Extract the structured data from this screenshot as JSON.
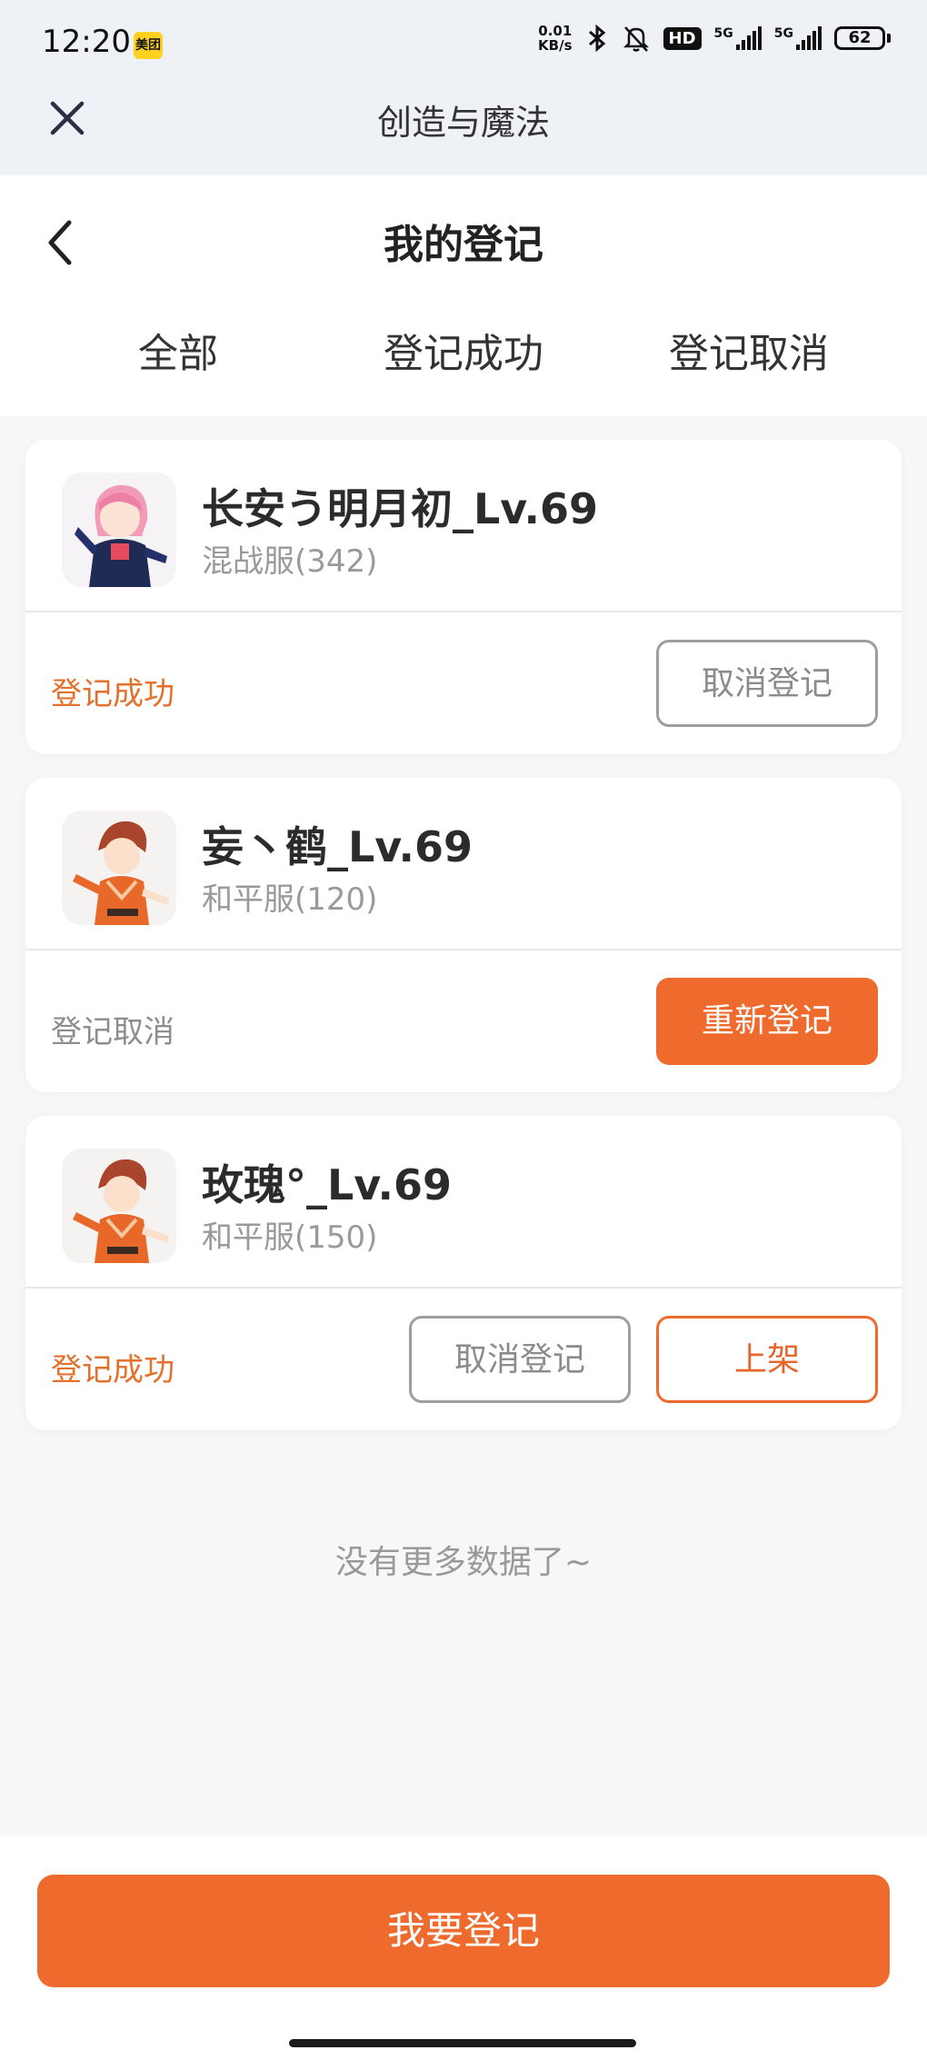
{
  "status_bar": {
    "time": "12:20",
    "app_badge": "美团",
    "net_speed_top": "0.01",
    "net_speed_bottom": "KB/s",
    "hd": "HD",
    "signal1": "5G",
    "signal2": "5G",
    "battery": "62"
  },
  "mini_program": {
    "title": "创造与魔法"
  },
  "page": {
    "title": "我的登记"
  },
  "tabs": [
    "全部",
    "登记成功",
    "登记取消"
  ],
  "records": [
    {
      "name": "长安う明月初_Lv.69",
      "server": "混战服(342)",
      "status": "登记成功",
      "buttons": [
        "取消登记"
      ]
    },
    {
      "name": "妄丶鹤_Lv.69",
      "server": "和平服(120)",
      "status": "登记取消",
      "buttons": [
        "重新登记"
      ]
    },
    {
      "name": "玫瑰°_Lv.69",
      "server": "和平服(150)",
      "status": "登记成功",
      "buttons": [
        "取消登记",
        "上架"
      ]
    }
  ],
  "footer_note": "没有更多数据了~",
  "primary_action": "我要登记",
  "colors": {
    "accent": "#ee6a2d",
    "status_ok": "#e3702b",
    "muted": "#9a9a9a"
  },
  "icons": [
    "close-icon",
    "back-arrow-icon",
    "bluetooth-icon",
    "bell-off-icon",
    "signal-icon",
    "battery-icon"
  ]
}
